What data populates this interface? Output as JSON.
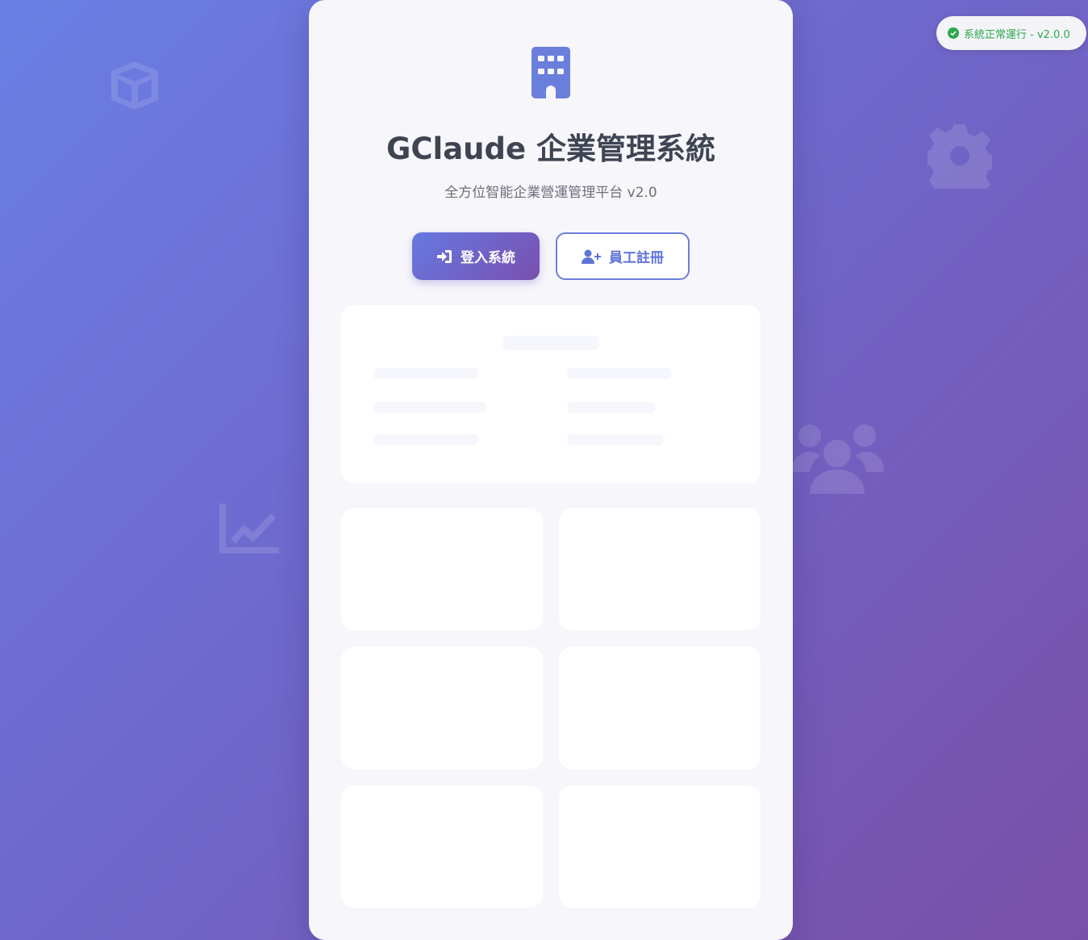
{
  "status": {
    "text": "系統正常運行 - v2.0.0",
    "color": "#2aa84a"
  },
  "header": {
    "logo_icon": "building-icon",
    "title": "GClaude 企業管理系統",
    "subtitle": "全方位智能企業營運管理平台 v2.0"
  },
  "actions": {
    "login_label": "登入系統",
    "login_icon": "sign-in-icon",
    "register_label": "員工註冊",
    "register_icon": "user-plus-icon"
  },
  "background_icons": [
    "cube-icon",
    "gear-icon",
    "users-icon",
    "chart-line-icon"
  ],
  "colors": {
    "accent": "#6a7edc",
    "accent_dark": "#7a4fb0",
    "title": "#3e4452"
  }
}
